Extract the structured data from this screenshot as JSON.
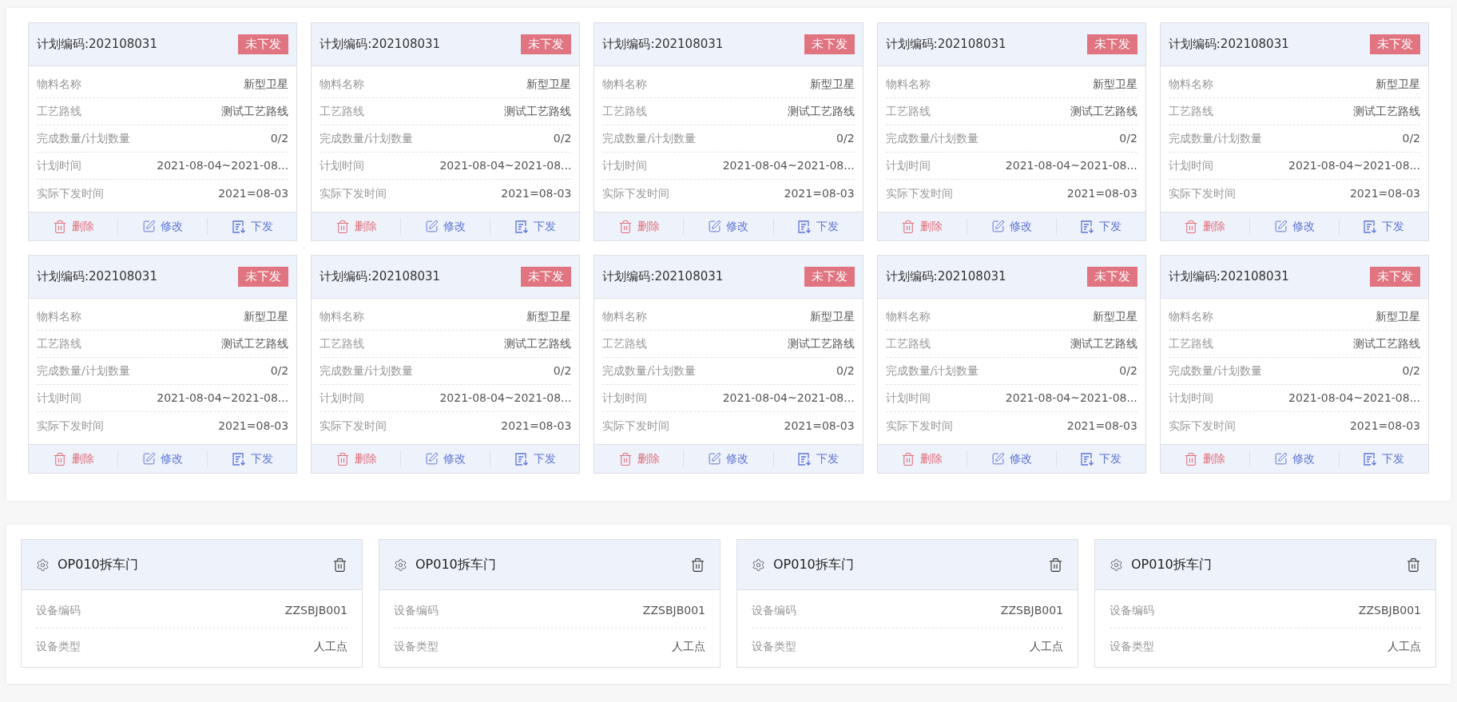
{
  "plans": [
    {
      "code": "计划编码:202108031",
      "status": "未下发",
      "fields": [
        {
          "label": "物料名称",
          "value": "新型卫星"
        },
        {
          "label": "工艺路线",
          "value": "测试工艺路线"
        },
        {
          "label": "完成数量/计划数量",
          "value": "0/2"
        },
        {
          "label": "计划时间",
          "value": "2021-08-04~2021-08..."
        },
        {
          "label": "实际下发时间",
          "value": "2021=08-03"
        }
      ],
      "actions": [
        {
          "kind": "delete",
          "label": "删除"
        },
        {
          "kind": "edit",
          "label": "修改"
        },
        {
          "kind": "dispatch",
          "label": "下发"
        }
      ]
    },
    {
      "code": "计划编码:202108031",
      "status": "未下发",
      "fields": [
        {
          "label": "物料名称",
          "value": "新型卫星"
        },
        {
          "label": "工艺路线",
          "value": "测试工艺路线"
        },
        {
          "label": "完成数量/计划数量",
          "value": "0/2"
        },
        {
          "label": "计划时间",
          "value": "2021-08-04~2021-08..."
        },
        {
          "label": "实际下发时间",
          "value": "2021=08-03"
        }
      ],
      "actions": [
        {
          "kind": "delete",
          "label": "删除"
        },
        {
          "kind": "edit",
          "label": "修改"
        },
        {
          "kind": "dispatch",
          "label": "下发"
        }
      ]
    },
    {
      "code": "计划编码:202108031",
      "status": "未下发",
      "fields": [
        {
          "label": "物料名称",
          "value": "新型卫星"
        },
        {
          "label": "工艺路线",
          "value": "测试工艺路线"
        },
        {
          "label": "完成数量/计划数量",
          "value": "0/2"
        },
        {
          "label": "计划时间",
          "value": "2021-08-04~2021-08..."
        },
        {
          "label": "实际下发时间",
          "value": "2021=08-03"
        }
      ],
      "actions": [
        {
          "kind": "delete",
          "label": "删除"
        },
        {
          "kind": "edit",
          "label": "修改"
        },
        {
          "kind": "dispatch",
          "label": "下发"
        }
      ]
    },
    {
      "code": "计划编码:202108031",
      "status": "未下发",
      "fields": [
        {
          "label": "物料名称",
          "value": "新型卫星"
        },
        {
          "label": "工艺路线",
          "value": "测试工艺路线"
        },
        {
          "label": "完成数量/计划数量",
          "value": "0/2"
        },
        {
          "label": "计划时间",
          "value": "2021-08-04~2021-08..."
        },
        {
          "label": "实际下发时间",
          "value": "2021=08-03"
        }
      ],
      "actions": [
        {
          "kind": "delete",
          "label": "删除"
        },
        {
          "kind": "edit",
          "label": "修改"
        },
        {
          "kind": "dispatch",
          "label": "下发"
        }
      ]
    },
    {
      "code": "计划编码:202108031",
      "status": "未下发",
      "fields": [
        {
          "label": "物料名称",
          "value": "新型卫星"
        },
        {
          "label": "工艺路线",
          "value": "测试工艺路线"
        },
        {
          "label": "完成数量/计划数量",
          "value": "0/2"
        },
        {
          "label": "计划时间",
          "value": "2021-08-04~2021-08..."
        },
        {
          "label": "实际下发时间",
          "value": "2021=08-03"
        }
      ],
      "actions": [
        {
          "kind": "delete",
          "label": "删除"
        },
        {
          "kind": "edit",
          "label": "修改"
        },
        {
          "kind": "dispatch",
          "label": "下发"
        }
      ]
    },
    {
      "code": "计划编码:202108031",
      "status": "未下发",
      "fields": [
        {
          "label": "物料名称",
          "value": "新型卫星"
        },
        {
          "label": "工艺路线",
          "value": "测试工艺路线"
        },
        {
          "label": "完成数量/计划数量",
          "value": "0/2"
        },
        {
          "label": "计划时间",
          "value": "2021-08-04~2021-08..."
        },
        {
          "label": "实际下发时间",
          "value": "2021=08-03"
        }
      ],
      "actions": [
        {
          "kind": "delete",
          "label": "删除"
        },
        {
          "kind": "edit",
          "label": "修改"
        },
        {
          "kind": "dispatch",
          "label": "下发"
        }
      ]
    },
    {
      "code": "计划编码:202108031",
      "status": "未下发",
      "fields": [
        {
          "label": "物料名称",
          "value": "新型卫星"
        },
        {
          "label": "工艺路线",
          "value": "测试工艺路线"
        },
        {
          "label": "完成数量/计划数量",
          "value": "0/2"
        },
        {
          "label": "计划时间",
          "value": "2021-08-04~2021-08..."
        },
        {
          "label": "实际下发时间",
          "value": "2021=08-03"
        }
      ],
      "actions": [
        {
          "kind": "delete",
          "label": "删除"
        },
        {
          "kind": "edit",
          "label": "修改"
        },
        {
          "kind": "dispatch",
          "label": "下发"
        }
      ]
    },
    {
      "code": "计划编码:202108031",
      "status": "未下发",
      "fields": [
        {
          "label": "物料名称",
          "value": "新型卫星"
        },
        {
          "label": "工艺路线",
          "value": "测试工艺路线"
        },
        {
          "label": "完成数量/计划数量",
          "value": "0/2"
        },
        {
          "label": "计划时间",
          "value": "2021-08-04~2021-08..."
        },
        {
          "label": "实际下发时间",
          "value": "2021=08-03"
        }
      ],
      "actions": [
        {
          "kind": "delete",
          "label": "删除"
        },
        {
          "kind": "edit",
          "label": "修改"
        },
        {
          "kind": "dispatch",
          "label": "下发"
        }
      ]
    },
    {
      "code": "计划编码:202108031",
      "status": "未下发",
      "fields": [
        {
          "label": "物料名称",
          "value": "新型卫星"
        },
        {
          "label": "工艺路线",
          "value": "测试工艺路线"
        },
        {
          "label": "完成数量/计划数量",
          "value": "0/2"
        },
        {
          "label": "计划时间",
          "value": "2021-08-04~2021-08..."
        },
        {
          "label": "实际下发时间",
          "value": "2021=08-03"
        }
      ],
      "actions": [
        {
          "kind": "delete",
          "label": "删除"
        },
        {
          "kind": "edit",
          "label": "修改"
        },
        {
          "kind": "dispatch",
          "label": "下发"
        }
      ]
    },
    {
      "code": "计划编码:202108031",
      "status": "未下发",
      "fields": [
        {
          "label": "物料名称",
          "value": "新型卫星"
        },
        {
          "label": "工艺路线",
          "value": "测试工艺路线"
        },
        {
          "label": "完成数量/计划数量",
          "value": "0/2"
        },
        {
          "label": "计划时间",
          "value": "2021-08-04~2021-08..."
        },
        {
          "label": "实际下发时间",
          "value": "2021=08-03"
        }
      ],
      "actions": [
        {
          "kind": "delete",
          "label": "删除"
        },
        {
          "kind": "edit",
          "label": "修改"
        },
        {
          "kind": "dispatch",
          "label": "下发"
        }
      ]
    }
  ],
  "stations": [
    {
      "title": "OP010拆车门",
      "fields": [
        {
          "label": "设备编码",
          "value": "ZZSBJB001"
        },
        {
          "label": "设备类型",
          "value": "人工点"
        }
      ]
    },
    {
      "title": "OP010拆车门",
      "fields": [
        {
          "label": "设备编码",
          "value": "ZZSBJB001"
        },
        {
          "label": "设备类型",
          "value": "人工点"
        }
      ]
    },
    {
      "title": "OP010拆车门",
      "fields": [
        {
          "label": "设备编码",
          "value": "ZZSBJB001"
        },
        {
          "label": "设备类型",
          "value": "人工点"
        }
      ]
    },
    {
      "title": "OP010拆车门",
      "fields": [
        {
          "label": "设备编码",
          "value": "ZZSBJB001"
        },
        {
          "label": "设备类型",
          "value": "人工点"
        }
      ]
    }
  ]
}
